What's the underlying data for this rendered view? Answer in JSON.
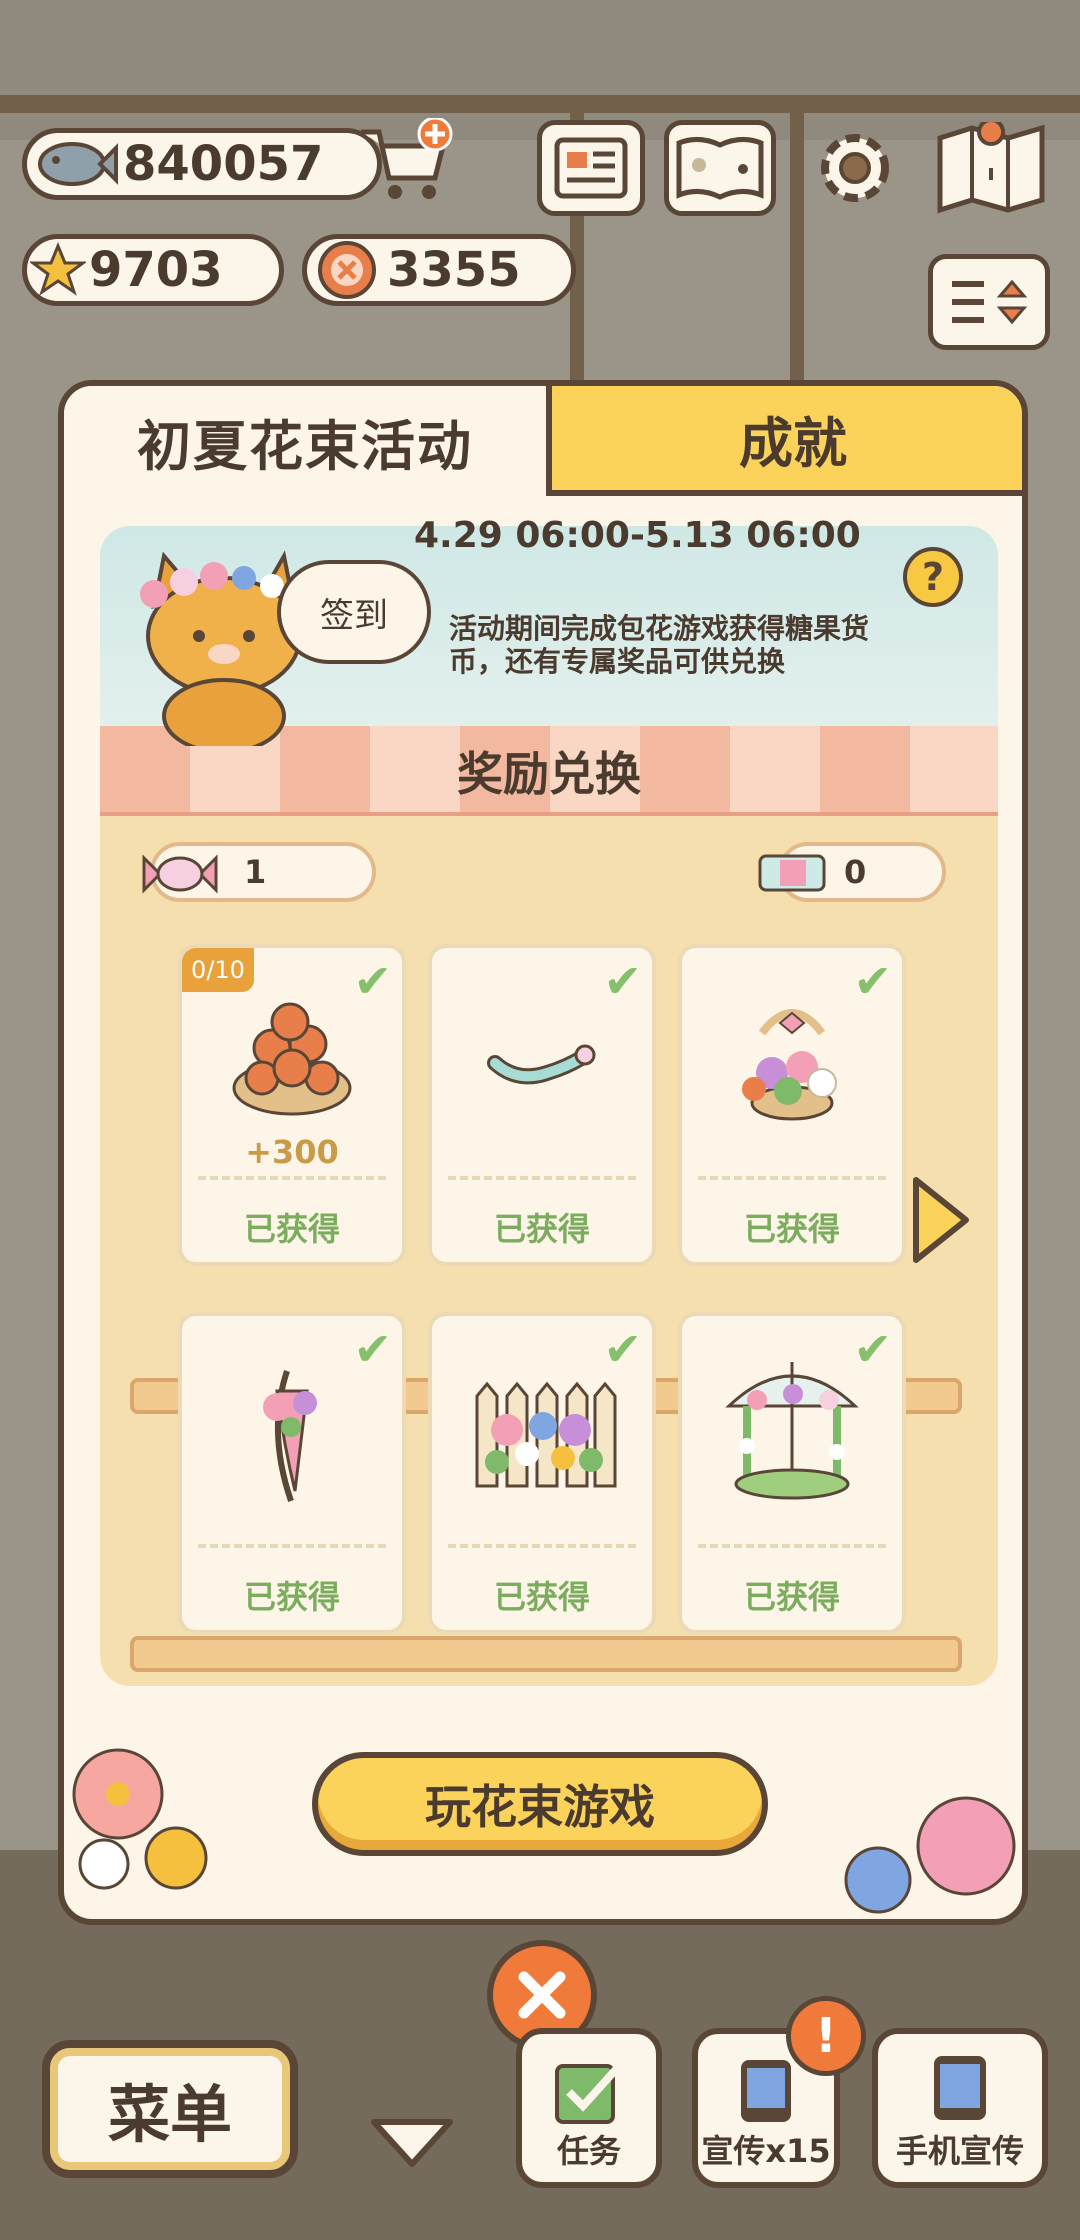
{
  "hud": {
    "fish": "840057",
    "stars": "9703",
    "buttons": "3355"
  },
  "modal": {
    "tab_active": "初夏花束活动",
    "tab_inactive": "成就",
    "bubble": "签到",
    "date_range": "4.29 06:00-5.13 06:00",
    "description": "活动期间完成包花游戏获得糖果货币，还有专属奖品可供兑换",
    "help": "?",
    "section_title": "奖励兑换",
    "candy_count": "1",
    "ticket_count": "0",
    "rewards": [
      {
        "progress": "0/10",
        "amount": "+300",
        "status": "已获得",
        "icon": "buttons-basket-icon"
      },
      {
        "status": "已获得",
        "icon": "ribbon-icon"
      },
      {
        "status": "已获得",
        "icon": "flower-basket-icon"
      },
      {
        "status": "已获得",
        "icon": "flower-umbrella-icon"
      },
      {
        "status": "已获得",
        "icon": "flower-fence-icon"
      },
      {
        "status": "已获得",
        "icon": "flower-gazebo-icon"
      }
    ],
    "play_button": "玩花束游戏"
  },
  "bottom": {
    "menu": "菜单",
    "tasks": "任务",
    "promo": "宣传x15",
    "phone_promo": "手机宣传"
  },
  "colors": {
    "accent_yellow": "#fbd25a",
    "outline_brown": "#5a4636",
    "cream": "#fdf6e8",
    "obtained_green": "#7cac5e",
    "close_orange": "#f07a3a"
  }
}
